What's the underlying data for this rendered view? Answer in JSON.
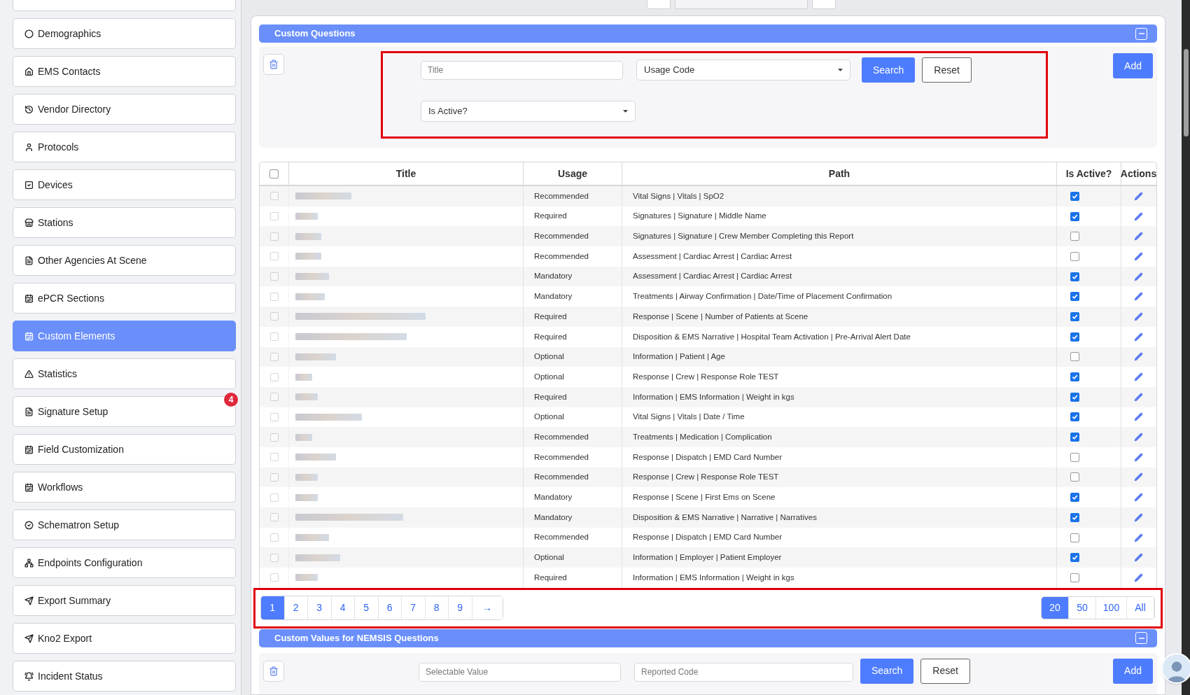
{
  "sidebar": {
    "items": [
      {
        "label": "Demographics",
        "selected": false
      },
      {
        "label": "EMS Contacts",
        "selected": false
      },
      {
        "label": "Vendor Directory",
        "selected": false
      },
      {
        "label": "Protocols",
        "selected": false
      },
      {
        "label": "Devices",
        "selected": false
      },
      {
        "label": "Stations",
        "selected": false
      },
      {
        "label": "Other Agencies At Scene",
        "selected": false
      },
      {
        "label": "ePCR Sections",
        "selected": false
      },
      {
        "label": "Custom Elements",
        "selected": true
      },
      {
        "label": "Statistics",
        "selected": false
      },
      {
        "label": "Signature Setup",
        "selected": false,
        "badge": "4"
      },
      {
        "label": "Field Customization",
        "selected": false
      },
      {
        "label": "Workflows",
        "selected": false
      },
      {
        "label": "Schematron Setup",
        "selected": false
      },
      {
        "label": "Endpoints Configuration",
        "selected": false
      },
      {
        "label": "Export Summary",
        "selected": false
      },
      {
        "label": "Kno2 Export",
        "selected": false
      },
      {
        "label": "Incident Status",
        "selected": false
      }
    ]
  },
  "custom_questions": {
    "title": "Custom Questions",
    "filters": {
      "title": {
        "placeholder": "Title"
      },
      "usage_code": {
        "value": "Usage Code"
      },
      "is_active": {
        "value": "Is Active?"
      },
      "buttons": [
        "Search",
        "Reset"
      ]
    },
    "add_button": "Add",
    "table": {
      "columns": [
        "Title",
        "Usage",
        "Path",
        "Is Active?",
        "Actions"
      ],
      "select_all": {
        "checked": false
      },
      "rows": [
        {
          "selected": false,
          "usage": "Recommended",
          "path": "Vital Signs | Vitals | SpO2",
          "active": true
        },
        {
          "selected": false,
          "usage": "Required",
          "path": "Signatures | Signature | Middle Name",
          "active": true
        },
        {
          "selected": false,
          "usage": "Recommended",
          "path": "Signatures | Signature | Crew Member Completing this Report",
          "active": false
        },
        {
          "selected": false,
          "usage": "Recommended",
          "path": "Assessment | Cardiac Arrest | Cardiac Arrest",
          "active": false
        },
        {
          "selected": false,
          "usage": "Mandatory",
          "path": "Assessment | Cardiac Arrest | Cardiac Arrest",
          "active": true
        },
        {
          "selected": false,
          "usage": "Mandatory",
          "path": "Treatments | Airway Confirmation | Date/Time of Placement Confirmation",
          "active": true
        },
        {
          "selected": false,
          "usage": "Required",
          "path": "Response | Scene | Number of Patients at Scene",
          "active": true
        },
        {
          "selected": false,
          "usage": "Required",
          "path": "Disposition & EMS Narrative | Hospital Team Activation | Pre-Arrival Alert Date",
          "active": true
        },
        {
          "selected": false,
          "usage": "Optional",
          "path": "Information | Patient | Age",
          "active": false
        },
        {
          "selected": false,
          "usage": "Optional",
          "path": "Response | Crew | Response Role TEST",
          "active": true
        },
        {
          "selected": false,
          "usage": "Required",
          "path": "Information | EMS Information | Weight in kgs",
          "active": true
        },
        {
          "selected": false,
          "usage": "Optional",
          "path": "Vital Signs | Vitals | Date / Time",
          "active": true
        },
        {
          "selected": false,
          "usage": "Recommended",
          "path": "Treatments | Medication | Complication",
          "active": true
        },
        {
          "selected": false,
          "usage": "Recommended",
          "path": "Response | Dispatch | EMD Card Number",
          "active": false
        },
        {
          "selected": false,
          "usage": "Recommended",
          "path": "Response | Crew | Response Role TEST",
          "active": false
        },
        {
          "selected": false,
          "usage": "Mandatory",
          "path": "Response | Scene | First Ems on Scene",
          "active": true
        },
        {
          "selected": false,
          "usage": "Mandatory",
          "path": "Disposition & EMS Narrative | Narrative | Narratives",
          "active": true
        },
        {
          "selected": false,
          "usage": "Recommended",
          "path": "Response | Dispatch | EMD Card Number",
          "active": false
        },
        {
          "selected": false,
          "usage": "Optional",
          "path": "Information | Employer | Patient Employer",
          "active": true
        },
        {
          "selected": false,
          "usage": "Required",
          "path": "Information | EMS Information | Weight in kgs",
          "active": false
        }
      ]
    },
    "pagination": {
      "pages": [
        {
          "label": "1",
          "selected": true
        },
        {
          "label": "2",
          "selected": false
        },
        {
          "label": "3",
          "selected": false
        },
        {
          "label": "4",
          "selected": false
        },
        {
          "label": "5",
          "selected": false
        },
        {
          "label": "6",
          "selected": false
        },
        {
          "label": "7",
          "selected": false
        },
        {
          "label": "8",
          "selected": false
        },
        {
          "label": "9",
          "selected": false
        }
      ],
      "next": "→",
      "page_sizes": [
        {
          "label": "20",
          "selected": true
        },
        {
          "label": "50",
          "selected": false
        },
        {
          "label": "100",
          "selected": false
        },
        {
          "label": "All",
          "selected": false
        }
      ]
    }
  },
  "custom_values": {
    "title": "Custom Values for NEMSIS Questions",
    "filters": {
      "selectable_value": {
        "placeholder": "Selectable Value"
      },
      "reported_code": {
        "placeholder": "Reported Code"
      },
      "buttons": [
        "Search",
        "Reset"
      ]
    },
    "add_button": "Add"
  }
}
